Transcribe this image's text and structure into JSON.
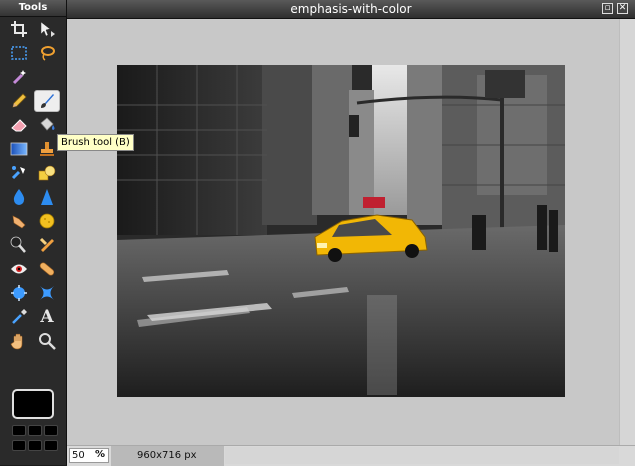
{
  "tools_panel": {
    "title": "Tools",
    "tools": [
      {
        "name": "crop-tool",
        "icon": "crop-icon"
      },
      {
        "name": "move-tool",
        "icon": "move-arrow-icon"
      },
      {
        "name": "marquee-tool",
        "icon": "marquee-icon"
      },
      {
        "name": "lasso-tool",
        "icon": "lasso-icon"
      },
      {
        "name": "magic-wand-tool",
        "icon": "magic-wand-icon"
      },
      {
        "name": "empty-slot",
        "icon": ""
      },
      {
        "name": "pencil-tool",
        "icon": "pencil-icon"
      },
      {
        "name": "brush-tool",
        "icon": "brush-icon",
        "active": true
      },
      {
        "name": "eraser-tool",
        "icon": "eraser-icon"
      },
      {
        "name": "paint-bucket-tool",
        "icon": "paint-bucket-icon"
      },
      {
        "name": "gradient-tool",
        "icon": "gradient-icon"
      },
      {
        "name": "clone-stamp-tool",
        "icon": "stamp-icon"
      },
      {
        "name": "color-replace-tool",
        "icon": "color-replace-icon"
      },
      {
        "name": "drawing-tool",
        "icon": "shapes-icon"
      },
      {
        "name": "blur-tool",
        "icon": "drop-icon"
      },
      {
        "name": "sharpen-tool",
        "icon": "triangle-icon"
      },
      {
        "name": "smudge-tool",
        "icon": "finger-icon"
      },
      {
        "name": "sponge-tool",
        "icon": "sponge-icon"
      },
      {
        "name": "dodge-tool",
        "icon": "dodge-icon"
      },
      {
        "name": "burn-tool",
        "icon": "burn-icon"
      },
      {
        "name": "red-eye-tool",
        "icon": "eye-icon"
      },
      {
        "name": "spot-heal-tool",
        "icon": "bandage-icon"
      },
      {
        "name": "bloat-tool",
        "icon": "bloat-icon"
      },
      {
        "name": "pinch-tool",
        "icon": "pinch-icon"
      },
      {
        "name": "color-picker-tool",
        "icon": "eyedropper-icon"
      },
      {
        "name": "type-tool",
        "icon": "type-icon",
        "glyph": "A"
      },
      {
        "name": "hand-tool",
        "icon": "hand-icon"
      },
      {
        "name": "zoom-tool",
        "icon": "zoom-icon"
      }
    ]
  },
  "tooltip": {
    "text": "Brush tool (B)"
  },
  "document": {
    "title": "emphasis-with-color",
    "zoom_value": "50",
    "zoom_unit": "%",
    "image_size": "960x716 px"
  },
  "colors": {
    "taxi": "#f2b705",
    "primary_color": "#000000"
  }
}
